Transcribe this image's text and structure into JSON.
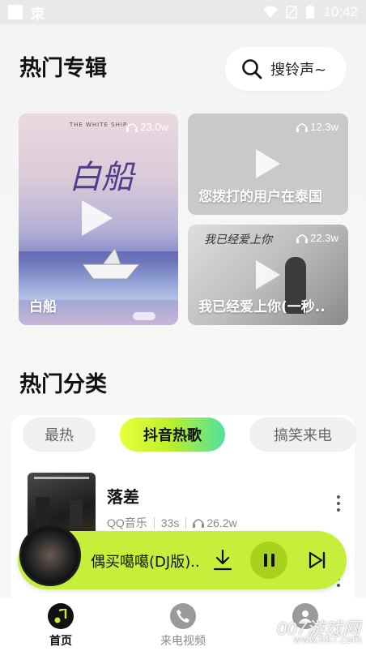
{
  "status_bar": {
    "time": "10:42",
    "app_glyph": "朿"
  },
  "header": {
    "title": "热门专辑",
    "search_placeholder": "搜铃声~"
  },
  "albums": [
    {
      "title": "白船",
      "count": "23.0w",
      "cover_text": "THE WHITE SHIP",
      "cover_script": "白船"
    },
    {
      "title": "您拨打的用户在泰国",
      "count": "12.3w"
    },
    {
      "title": "我已经爱上你(一秒..",
      "count": "22.3w",
      "cover_script": "我已经爱上你"
    }
  ],
  "categories": {
    "title": "热门分类",
    "tabs": [
      {
        "label": "最热",
        "active": false
      },
      {
        "label": "抖音热歌",
        "active": true
      },
      {
        "label": "搞笑来电",
        "active": false
      }
    ]
  },
  "songs": [
    {
      "name": "落差",
      "source": "QQ音乐",
      "duration": "33s",
      "plays": "26.2w"
    }
  ],
  "player": {
    "title": "偶买噶噶(DJ版)..",
    "state": "playing"
  },
  "bottom_nav": [
    {
      "label": "首页",
      "active": true
    },
    {
      "label": "来电视频",
      "active": false
    },
    {
      "label": "",
      "active": false
    }
  ],
  "watermark": {
    "main": "007游戏网",
    "sub": "www.007.com"
  },
  "colors": {
    "accent": "#c5ef3a",
    "tab_gradient_start": "#eaff3a",
    "tab_gradient_end": "#4fe1a0"
  }
}
